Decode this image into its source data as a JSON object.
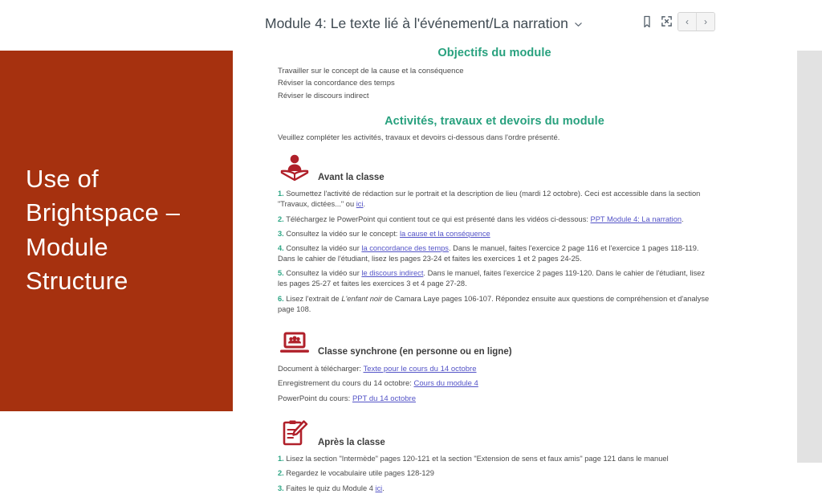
{
  "topbar": {
    "module_title": "Module 4: Le texte lié à l'événement/La narration",
    "chevron_icon": "chevron-down-icon",
    "bookmark_icon": "bookmark-icon",
    "expand_icon": "expand-icon",
    "prev_label": "‹",
    "next_label": "›"
  },
  "slide": {
    "title": "Use of\nBrightspace –\nModule\nStructure",
    "background_color": "#A6310F",
    "text_color": "#FFFFFF"
  },
  "colors": {
    "heading_teal": "#28A17E",
    "list_number_teal": "#2EA685",
    "link_purple": "#5353C7",
    "icon_red": "#B0202A",
    "slide_red": "#A6310F",
    "right_strip_gray": "#E2E2E2"
  },
  "doc": {
    "objectives": {
      "heading": "Objectifs du module",
      "lines": [
        "Travailler sur le concept de la cause et la conséquence",
        "Réviser la concordance des temps",
        "Réviser le discours indirect"
      ]
    },
    "activities": {
      "heading": "Activités, travaux et devoirs du module",
      "intro": "Veuillez compléter les activités, travaux et devoirs ci-dessous dans l'ordre présenté."
    },
    "before_class": {
      "icon": "person-reading-book-icon",
      "title": "Avant la classe",
      "items": [
        {
          "num": "1.",
          "pre": "Soumettez l'activité de rédaction sur le portrait et la description de lieu (mardi 12 octobre). Ceci est accessible dans la section \"Travaux, dictées...\" ou ",
          "link": "ici",
          "post": "."
        },
        {
          "num": "2.",
          "pre": "Téléchargez le PowerPoint qui contient tout ce qui est présenté dans les vidéos ci-dessous: ",
          "link": "PPT Module 4: La narration",
          "post": "."
        },
        {
          "num": "3.",
          "pre": "Consultez la vidéo sur le concept: ",
          "link": "la cause et la conséquence",
          "post": ""
        },
        {
          "num": "4.",
          "pre": "Consultez la vidéo sur ",
          "link": "la concordance des temps",
          "post": ". Dans le manuel, faites l'exercice 2 page 116 et l'exercice 1 pages 118-119. Dans le cahier de l'étudiant, lisez les pages 23-24 et faites les exercices 1 et 2 pages 24-25."
        },
        {
          "num": "5.",
          "pre": "Consultez la vidéo sur ",
          "link": "le discours indirect",
          "post": ". Dans le manuel, faites l'exercice 2 pages 119-120. Dans le cahier de l'étudiant, lisez les pages 25-27 et faites les exercices 3 et 4 page 27-28."
        },
        {
          "num": "6.",
          "pre": "Lisez l'extrait de ",
          "italic": "L'enfant noir",
          "post": " de Camara Laye pages 106-107. Répondez ensuite aux questions de compréhension et d'analyse page 108."
        }
      ]
    },
    "synchronous_class": {
      "icon": "laptop-people-icon",
      "title": "Classe synchrone (en personne ou en ligne)",
      "lines": [
        {
          "label": "Document à télécharger: ",
          "link": "Texte pour le cours du 14 octobre"
        },
        {
          "label": "Enregistrement du cours du 14 octobre: ",
          "link": "Cours du module 4"
        },
        {
          "label": "PowerPoint du cours: ",
          "link": "PPT du 14 octobre"
        }
      ]
    },
    "after_class": {
      "icon": "clipboard-pencil-icon",
      "title": "Après la classe",
      "items": [
        {
          "num": "1.",
          "pre": "Lisez la section \"Intermède\" pages 120-121 et la section \"Extension de sens et faux amis\" page 121 dans le manuel",
          "link": "",
          "post": ""
        },
        {
          "num": "2.",
          "pre": "Regardez le vocabulaire utile pages 128-129",
          "link": "",
          "post": ""
        },
        {
          "num": "3.",
          "pre": "Faites le quiz du Module 4 ",
          "link": "ici",
          "post": "."
        }
      ]
    }
  }
}
